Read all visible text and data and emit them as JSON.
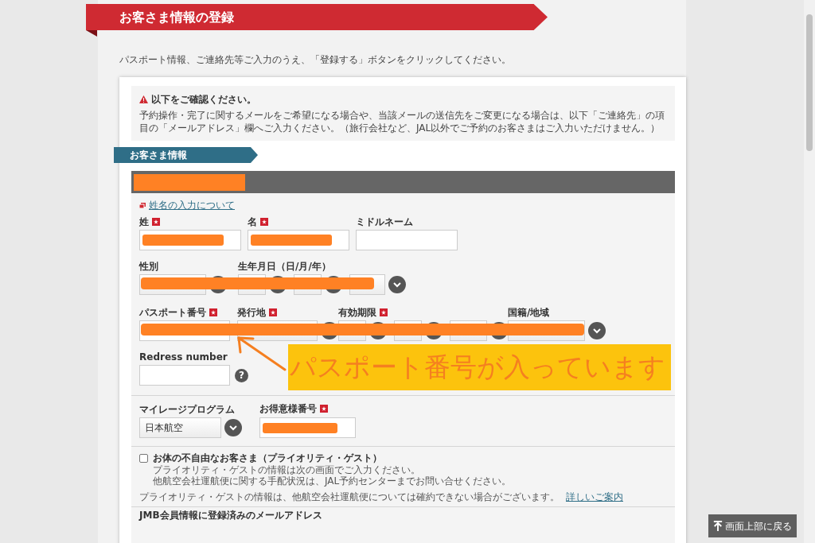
{
  "page_title": "お客さま情報の登録",
  "intro": "パスポート情報、ご連絡先等ご入力のうえ、「登録する」ボタンをクリックしてください。",
  "notice": {
    "title": "以下をご確認ください。",
    "body": "予約操作・完了に関するメールをご希望になる場合や、当該メールの送信先をご変更になる場合は、以下「ご連絡先」の項目の「メールアドレス」欄へご入力ください。（旅行会社など、JAL以外でご予約のお客さまはご入力いただけません。）"
  },
  "section_tab": "お客さま情報",
  "passenger_bar": {
    "redacted": true
  },
  "name_help_link": "姓名の入力について",
  "form_rows": [
    {
      "redacted_line": false,
      "fields": [
        {
          "label": "姓",
          "required": true,
          "kind": "text",
          "redacted": true
        },
        {
          "label": "名",
          "required": true,
          "kind": "text",
          "redacted": true
        },
        {
          "label": "ミドルネーム",
          "required": false,
          "kind": "text",
          "redacted": false
        }
      ]
    },
    {
      "redacted_line": true,
      "fields": [
        {
          "label": "性別",
          "required": false,
          "kind": "select"
        },
        {
          "label": "生年月日（日/月/年）",
          "required": false,
          "kind": "date"
        }
      ]
    },
    {
      "redacted_line": true,
      "fields": [
        {
          "label": "パスポート番号",
          "required": true,
          "kind": "text",
          "redacted": false
        },
        {
          "label": "発行地",
          "required": true,
          "kind": "select"
        },
        {
          "label": "有効期限",
          "required": true,
          "kind": "date"
        },
        {
          "label": "国籍/地域",
          "required": false,
          "kind": "select"
        }
      ]
    },
    {
      "redacted_line": false,
      "fields": [
        {
          "label": "Redress number",
          "required": false,
          "kind": "text",
          "redacted": false,
          "help": "?"
        }
      ]
    }
  ],
  "callout": {
    "text": "パスポート番号が入っています"
  },
  "mileage": {
    "program_label": "マイレージプログラム",
    "program_value": "日本航空",
    "number_label": "お得意様番号",
    "number_required": true,
    "number_redacted": true
  },
  "priority_guest": {
    "label": "お体の不自由なお客さま（プライオリティ・ゲスト）",
    "checked": false,
    "lines": [
      "プライオリティ・ゲストの情報は次の画面でご入力ください。",
      "他航空会社運航便に関する手配状況は、JAL予約センターまでお問い合せください。"
    ],
    "note": "プライオリティ・ゲストの情報は、他航空会社運航便については確約できない場合がございます。",
    "note_link": "詳しいご案内"
  },
  "next_section": "JMB会員情報に登録済みのメールアドレス",
  "back_to_top": "画面上部に戻る"
}
